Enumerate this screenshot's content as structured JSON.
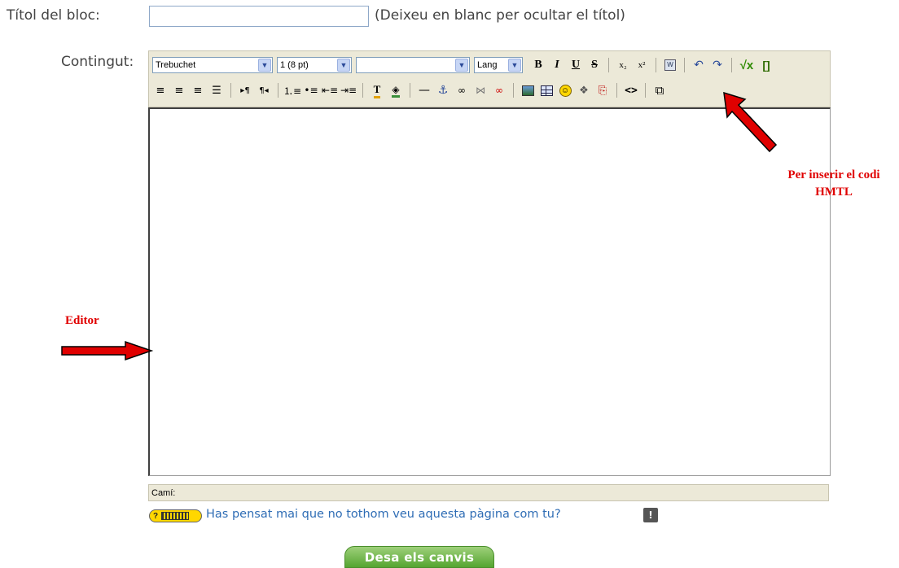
{
  "form": {
    "title_label": "Títol del bloc:",
    "title_value": "",
    "title_hint": "(Deixeu en blanc per ocultar el títol)",
    "content_label": "Contingut:"
  },
  "toolbar": {
    "font_select": "Trebuchet",
    "size_select": "1 (8 pt)",
    "format_select": "",
    "lang_select": "Lang",
    "bold": "B",
    "italic": "I",
    "underline": "U",
    "strike": "S",
    "subscript": "x₂",
    "superscript": "x²",
    "undo": "↶",
    "redo": "↷",
    "html_toggle": "<>",
    "fullscreen": "⧉"
  },
  "editor": {
    "path_label": "Camí:"
  },
  "accessibility": {
    "badge": "?",
    "link_text": "Has pensat mai que no tothom veu aquesta pàgina com tu?",
    "warn": "!"
  },
  "save_label": "Desa els canvis",
  "annotations": {
    "editor": "Editor",
    "html_line1": "Per inserir el codi",
    "html_line2": "HMTL"
  },
  "colors": {
    "annotation": "#e00000",
    "save_button": "#6cb843",
    "link": "#2f6db5"
  }
}
